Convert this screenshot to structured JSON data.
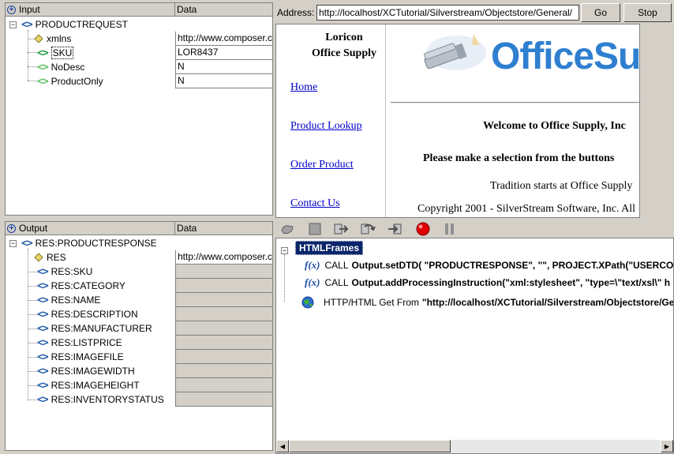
{
  "input": {
    "header_name": "Input",
    "header_data": "Data",
    "rows": [
      {
        "name": "PRODUCTREQUEST",
        "value": ""
      },
      {
        "name": "xmlns",
        "value": "http://www.composer.c"
      },
      {
        "name": "SKU",
        "value": "LOR8437"
      },
      {
        "name": "NoDesc",
        "value": "N"
      },
      {
        "name": "ProductOnly",
        "value": "N"
      }
    ]
  },
  "output": {
    "header_name": "Output",
    "header_data": "Data",
    "rows": [
      {
        "name": "RES:PRODUCTRESPONSE",
        "value": ""
      },
      {
        "name": "RES",
        "value": "http://www.composer.c"
      },
      {
        "name": "RES:SKU",
        "value": ""
      },
      {
        "name": "RES:CATEGORY",
        "value": ""
      },
      {
        "name": "RES:NAME",
        "value": ""
      },
      {
        "name": "RES:DESCRIPTION",
        "value": ""
      },
      {
        "name": "RES:MANUFACTURER",
        "value": ""
      },
      {
        "name": "RES:LISTPRICE",
        "value": ""
      },
      {
        "name": "RES:IMAGEFILE",
        "value": ""
      },
      {
        "name": "RES:IMAGEWIDTH",
        "value": ""
      },
      {
        "name": "RES:IMAGEHEIGHT",
        "value": ""
      },
      {
        "name": "RES:INVENTORYSTATUS",
        "value": ""
      }
    ]
  },
  "browser": {
    "address_label": "Address:",
    "address_value": "http://localhost/XCTutorial/Silverstream/Objectstore/General/",
    "go_label": "Go",
    "stop_label": "Stop",
    "company_line1": "Loricon",
    "company_line2": "Office Supply",
    "nav": [
      "Home",
      "Product Lookup",
      "Order Product",
      "Contact Us"
    ],
    "logo_text": "OfficeSu",
    "welcome": "Welcome to Office Supply, Inc",
    "instruction": "Please make a selection from the buttons",
    "tradition": "Tradition starts at Office Supply",
    "copyright": "Copyright 2001 - SilverStream Software, Inc. All"
  },
  "actions": {
    "root_label": "HTMLFrames",
    "items": [
      {
        "prefix": "CALL",
        "text": "Output.setDTD( \"PRODUCTRESPONSE\", \"\", PROJECT.XPath(\"USERCON"
      },
      {
        "prefix": "CALL",
        "text": "Output.addProcessingInstruction(\"xml:stylesheet\", \"type=\\\"text/xsl\\\" h"
      },
      {
        "prefix": "HTTP/HTML Get From",
        "text": "\"http://localhost/XCTutorial/Silverstream/Objectstore/Ge"
      }
    ],
    "fx_label": "f(x)"
  },
  "colors": {
    "selection": "#0a246a",
    "tag_blue": "#1f5aa8",
    "tag_green": "#1c9c3c",
    "record_red": "#e00000"
  }
}
